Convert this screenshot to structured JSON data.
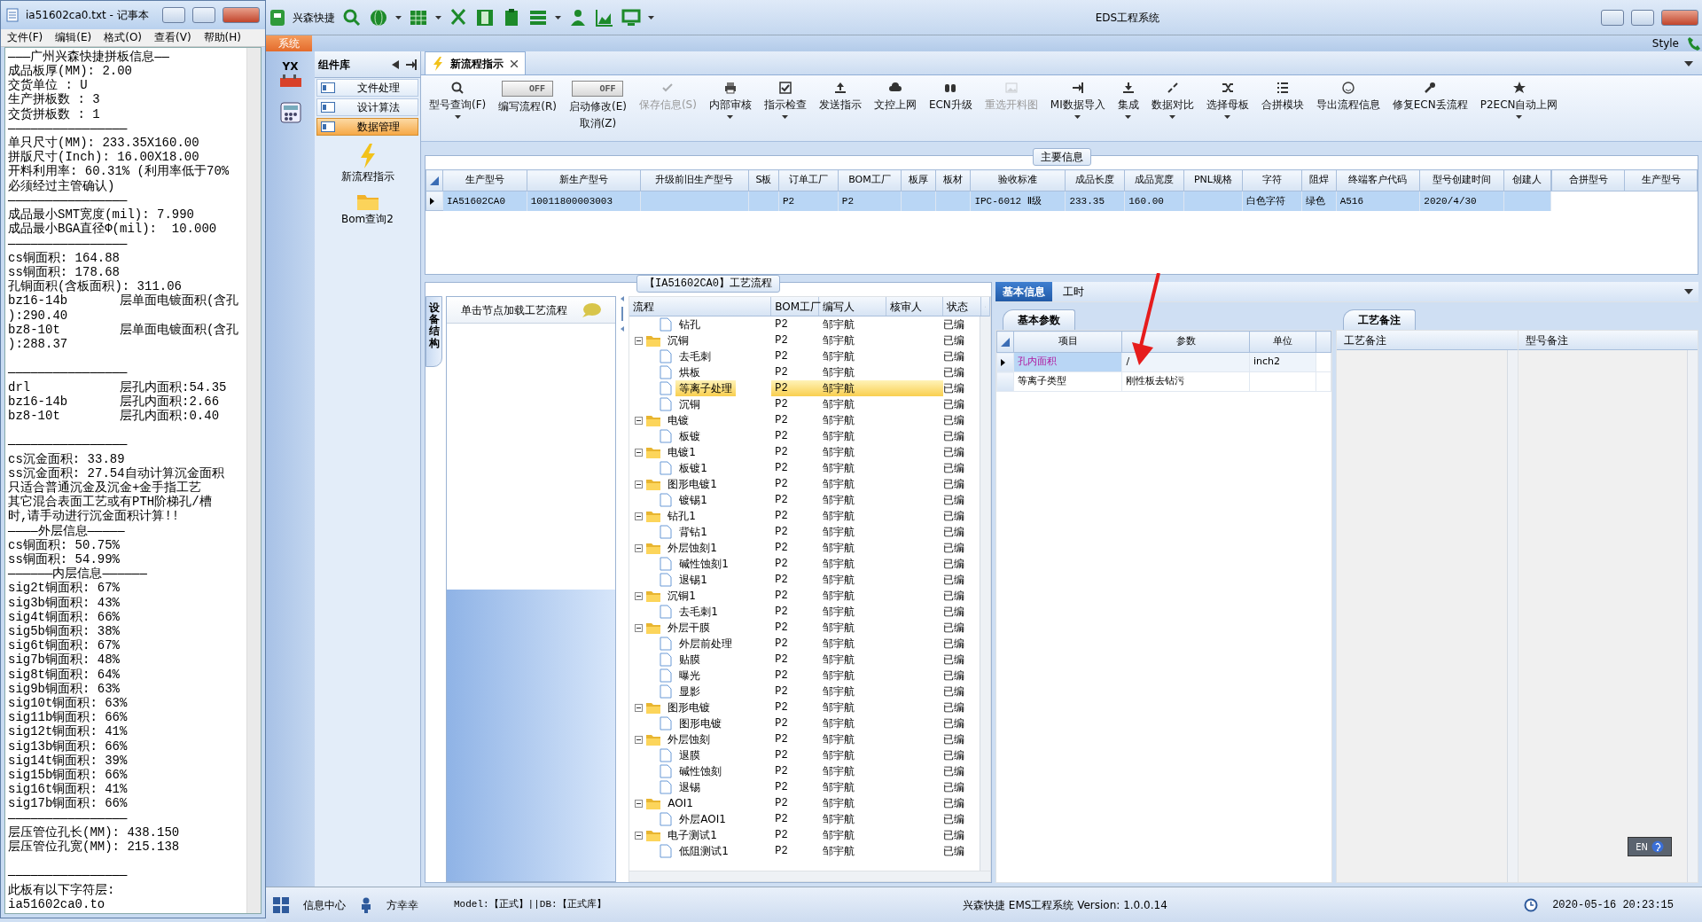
{
  "notepad": {
    "title": "ia51602ca0.txt - 记事本",
    "menu": [
      "文件(F)",
      "编辑(E)",
      "格式(O)",
      "查看(V)",
      "帮助(H)"
    ],
    "paragraphs": [
      [
        "———广州兴森快捷拼板信息——",
        "成品板厚(MM): 2.00",
        "交货单位 : U",
        "生产拼板数 : 3",
        "交货拼板数 : 1",
        "————————————————",
        "单只尺寸(MM): 233.35X160.00",
        "拼版尺寸(Inch): 16.00X18.00",
        "开料利用率: 60.31% (利用率低于70%",
        "必须经过主管确认)",
        "————————————————",
        "成品最小SMT宽度(mil): 7.990",
        "成品最小BGA直径Φ(mil):  10.000",
        "————————————————",
        "cs铜面积: 164.88",
        "ss铜面积: 178.68",
        "孔铜面积(含板面积): 311.06",
        "bz16-14b       层单面电镀面积(含孔",
        "):290.40",
        "bz8-10t        层单面电镀面积(含孔",
        "):288.37"
      ],
      [
        "————————————————",
        "drl            层孔内面积:54.35",
        "bz16-14b       层孔内面积:2.66",
        "bz8-10t        层孔内面积:0.40"
      ],
      [
        "————————————————",
        "cs沉金面积: 33.89",
        "ss沉金面积: 27.54自动计算沉金面积",
        "只适合普通沉金及沉金+金手指工艺",
        "其它混合表面工艺或有PTH阶梯孔/槽",
        "时,请手动进行沉金面积计算!!",
        "————外层信息—————",
        "cs铜面积: 50.75%",
        "ss铜面积: 54.99%",
        "——————内层信息——————",
        "sig2t铜面积: 67%",
        "sig3b铜面积: 43%",
        "sig4t铜面积: 66%",
        "sig5b铜面积: 38%",
        "sig6t铜面积: 67%",
        "sig7b铜面积: 48%",
        "sig8t铜面积: 64%",
        "sig9b铜面积: 63%",
        "sig10t铜面积: 63%",
        "sig11b铜面积: 66%",
        "sig12t铜面积: 41%",
        "sig13b铜面积: 66%",
        "sig14t铜面积: 39%",
        "sig15b铜面积: 66%",
        "sig16t铜面积: 41%",
        "sig17b铜面积: 66%",
        "————————————————",
        "层压管位孔长(MM): 438.150",
        "层压管位孔宽(MM): 215.138"
      ],
      [
        "————————————————",
        "此板有以下字符层:",
        "ia51602ca0.to"
      ]
    ]
  },
  "app": {
    "quick_access_label": "兴森快捷",
    "title": "EDS工程系统",
    "ribbon_tab": "系统",
    "style_label": "Style",
    "nav_logo": "YX"
  },
  "component_panel": {
    "title": "组件库",
    "items": [
      {
        "label": "文件处理",
        "selected": false
      },
      {
        "label": "设计算法",
        "selected": false
      },
      {
        "label": "数据管理",
        "selected": true
      }
    ],
    "launchers": [
      "新流程指示",
      "Bom查询2"
    ]
  },
  "document_tab": {
    "label": "新流程指示"
  },
  "toolbar": [
    {
      "kind": "button",
      "label": "型号查询(F)",
      "dropdown": true,
      "disabled": false
    },
    {
      "kind": "toggle",
      "label": "编写流程(R)",
      "toggle_text": "OFF",
      "on": false
    },
    {
      "kind": "toggle",
      "label": "启动修改(E)",
      "label2": "取消(Z)",
      "toggle_text": "OFF",
      "on": false
    },
    {
      "kind": "button",
      "label": "保存信息(S)",
      "dropdown": false,
      "disabled": true
    },
    {
      "kind": "button",
      "label": "内部审核",
      "dropdown": true,
      "disabled": false
    },
    {
      "kind": "button",
      "label": "指示检查",
      "dropdown": true,
      "disabled": false
    },
    {
      "kind": "button",
      "label": "发送指示",
      "dropdown": false,
      "disabled": false
    },
    {
      "kind": "button",
      "label": "文控上网",
      "dropdown": false,
      "disabled": false
    },
    {
      "kind": "button",
      "label": "ECN升级",
      "dropdown": false,
      "disabled": false
    },
    {
      "kind": "button",
      "label": "重选开料图",
      "dropdown": false,
      "disabled": true
    },
    {
      "kind": "button",
      "label": "MI数据导入",
      "dropdown": true,
      "disabled": false
    },
    {
      "kind": "button",
      "label": "集成",
      "dropdown": true,
      "disabled": false
    },
    {
      "kind": "button",
      "label": "数据对比",
      "dropdown": true,
      "disabled": false
    },
    {
      "kind": "button",
      "label": "选择母板",
      "dropdown": true,
      "disabled": false
    },
    {
      "kind": "button",
      "label": "合拼模块",
      "dropdown": false,
      "disabled": false
    },
    {
      "kind": "button",
      "label": "导出流程信息",
      "dropdown": false,
      "disabled": false
    },
    {
      "kind": "button",
      "label": "修复ECN丢流程",
      "dropdown": false,
      "disabled": false
    },
    {
      "kind": "button",
      "label": "P2ECN自动上网",
      "dropdown": true,
      "disabled": false
    }
  ],
  "main_info": {
    "title": "主要信息",
    "columns": [
      "生产型号",
      "新生产型号",
      "升级前旧生产型号",
      "S板",
      "订单工厂",
      "BOM工厂",
      "板厚",
      "板材",
      "验收标准",
      "成品长度",
      "成品宽度",
      "PNL规格",
      "字符",
      "阻焊",
      "终端客户代码",
      "型号创建时间",
      "创建人"
    ],
    "rows": [
      {
        "selected": true,
        "cells": [
          "IA51602CA0",
          "10011800003003",
          null,
          null,
          "P2",
          "P2",
          null,
          null,
          "IPC-6012 Ⅱ级",
          "233.35",
          "160.00",
          null,
          "白色字符",
          "绿色",
          "A516",
          "2020/4/30",
          null
        ]
      }
    ],
    "side_columns": [
      "合拼型号",
      "生产型号"
    ]
  },
  "process_flow": {
    "title": "【IA51602CA0】工艺流程",
    "side_tab": "设备结构",
    "hint": "单击节点加载工艺流程",
    "columns": [
      "流程",
      "BOM工厂",
      "编写人",
      "核审人",
      "状态"
    ],
    "tree": [
      {
        "label": "钻孔",
        "kind": "file",
        "bom": "P2",
        "author": "邹宇航",
        "status": "已编",
        "selected": false
      },
      {
        "label": "沉铜",
        "kind": "folder",
        "expanded": true,
        "bom": "P2",
        "author": "邹宇航",
        "status": "已编",
        "selected": false,
        "children": [
          {
            "label": "去毛刺",
            "kind": "file",
            "bom": "P2",
            "author": "邹宇航",
            "status": "已编",
            "selected": false
          },
          {
            "label": "烘板",
            "kind": "file",
            "bom": "P2",
            "author": "邹宇航",
            "status": "已编",
            "selected": false
          },
          {
            "label": "等离子处理",
            "kind": "file",
            "bom": "P2",
            "author": "邹宇航",
            "status": "已编",
            "selected": true
          },
          {
            "label": "沉铜",
            "kind": "file",
            "bom": "P2",
            "author": "邹宇航",
            "status": "已编",
            "selected": false
          }
        ]
      },
      {
        "label": "电镀",
        "kind": "folder",
        "expanded": true,
        "bom": "P2",
        "author": "邹宇航",
        "status": "已编",
        "selected": false,
        "children": [
          {
            "label": "板镀",
            "kind": "file",
            "bom": "P2",
            "author": "邹宇航",
            "status": "已编",
            "selected": false
          }
        ]
      },
      {
        "label": "电镀1",
        "kind": "folder",
        "expanded": true,
        "bom": "P2",
        "author": "邹宇航",
        "status": "已编",
        "selected": false,
        "children": [
          {
            "label": "板镀1",
            "kind": "file",
            "bom": "P2",
            "author": "邹宇航",
            "status": "已编",
            "selected": false
          }
        ]
      },
      {
        "label": "图形电镀1",
        "kind": "folder",
        "expanded": true,
        "bom": "P2",
        "author": "邹宇航",
        "status": "已编",
        "selected": false,
        "children": [
          {
            "label": "镀锡1",
            "kind": "file",
            "bom": "P2",
            "author": "邹宇航",
            "status": "已编",
            "selected": false
          }
        ]
      },
      {
        "label": "钻孔1",
        "kind": "folder",
        "expanded": true,
        "bom": "P2",
        "author": "邹宇航",
        "status": "已编",
        "selected": false,
        "children": [
          {
            "label": "背钻1",
            "kind": "file",
            "bom": "P2",
            "author": "邹宇航",
            "status": "已编",
            "selected": false
          }
        ]
      },
      {
        "label": "外层蚀刻1",
        "kind": "folder",
        "expanded": true,
        "bom": "P2",
        "author": "邹宇航",
        "status": "已编",
        "selected": false,
        "children": [
          {
            "label": "碱性蚀刻1",
            "kind": "file",
            "bom": "P2",
            "author": "邹宇航",
            "status": "已编",
            "selected": false
          },
          {
            "label": "退锡1",
            "kind": "file",
            "bom": "P2",
            "author": "邹宇航",
            "status": "已编",
            "selected": false
          }
        ]
      },
      {
        "label": "沉铜1",
        "kind": "folder",
        "expanded": true,
        "bom": "P2",
        "author": "邹宇航",
        "status": "已编",
        "selected": false,
        "children": [
          {
            "label": "去毛刺1",
            "kind": "file",
            "bom": "P2",
            "author": "邹宇航",
            "status": "已编",
            "selected": false
          }
        ]
      },
      {
        "label": "外层干膜",
        "kind": "folder",
        "expanded": true,
        "bom": "P2",
        "author": "邹宇航",
        "status": "已编",
        "selected": false,
        "children": [
          {
            "label": "外层前处理",
            "kind": "file",
            "bom": "P2",
            "author": "邹宇航",
            "status": "已编",
            "selected": false
          },
          {
            "label": "贴膜",
            "kind": "file",
            "bom": "P2",
            "author": "邹宇航",
            "status": "已编",
            "selected": false
          },
          {
            "label": "曝光",
            "kind": "file",
            "bom": "P2",
            "author": "邹宇航",
            "status": "已编",
            "selected": false
          },
          {
            "label": "显影",
            "kind": "file",
            "bom": "P2",
            "author": "邹宇航",
            "status": "已编",
            "selected": false
          }
        ]
      },
      {
        "label": "图形电镀",
        "kind": "folder",
        "expanded": true,
        "bom": "P2",
        "author": "邹宇航",
        "status": "已编",
        "selected": false,
        "children": [
          {
            "label": "图形电镀",
            "kind": "file",
            "bom": "P2",
            "author": "邹宇航",
            "status": "已编",
            "selected": false
          }
        ]
      },
      {
        "label": "外层蚀刻",
        "kind": "folder",
        "expanded": true,
        "bom": "P2",
        "author": "邹宇航",
        "status": "已编",
        "selected": false,
        "children": [
          {
            "label": "退膜",
            "kind": "file",
            "bom": "P2",
            "author": "邹宇航",
            "status": "已编",
            "selected": false
          },
          {
            "label": "碱性蚀刻",
            "kind": "file",
            "bom": "P2",
            "author": "邹宇航",
            "status": "已编",
            "selected": false
          },
          {
            "label": "退锡",
            "kind": "file",
            "bom": "P2",
            "author": "邹宇航",
            "status": "已编",
            "selected": false
          }
        ]
      },
      {
        "label": "AOI1",
        "kind": "folder",
        "expanded": true,
        "bom": "P2",
        "author": "邹宇航",
        "status": "已编",
        "selected": false,
        "children": [
          {
            "label": "外层AOI1",
            "kind": "file",
            "bom": "P2",
            "author": "邹宇航",
            "status": "已编",
            "selected": false
          }
        ]
      },
      {
        "label": "电子测试1",
        "kind": "folder",
        "expanded": true,
        "bom": "P2",
        "author": "邹宇航",
        "status": "已编",
        "selected": false,
        "children": [
          {
            "label": "低阻测试1",
            "kind": "file",
            "bom": "P2",
            "author": "邹宇航",
            "status": "已编",
            "selected": false
          }
        ]
      }
    ]
  },
  "detail_tabs": [
    {
      "label": "基本信息",
      "selected": true
    },
    {
      "label": "工时",
      "selected": false
    }
  ],
  "params": {
    "tab": "基本参数",
    "columns": [
      "项目",
      "参数",
      "单位"
    ],
    "rows": [
      {
        "selected": true,
        "cells": [
          "孔内面积",
          "/",
          "inch2"
        ]
      },
      {
        "selected": false,
        "cells": [
          "等离子类型",
          "刚性板去钻污",
          null
        ]
      }
    ]
  },
  "notes": {
    "tab": "工艺备注",
    "columns": [
      "工艺备注",
      "型号备注"
    ]
  },
  "language_bar": "EN",
  "status_bar": {
    "info_center": "信息中心",
    "user": "方幸幸",
    "model": "Model:【正式】||DB:【正式库】",
    "version": "兴森快捷 EMS工程系统 Version: 1.0.0.14",
    "time": "2020-05-16 20:23:15"
  }
}
